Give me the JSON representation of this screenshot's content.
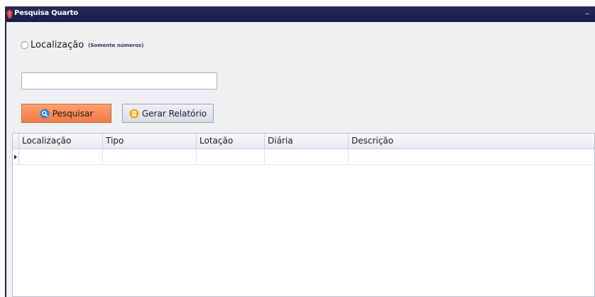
{
  "window": {
    "title": "Pesquisa Quarto",
    "minimize_label": "–"
  },
  "search": {
    "radio_label": "Localização",
    "radio_hint": "(Somente números)",
    "input_value": "",
    "search_button": "Pesquisar",
    "report_button": "Gerar Relatório"
  },
  "grid": {
    "columns": [
      "Localização",
      "Tipo",
      "Lotação",
      "Diária",
      "Descrição"
    ],
    "rows": [
      [
        "",
        "",
        "",
        "",
        ""
      ]
    ]
  },
  "colors": {
    "titlebar": "#1a1d47",
    "search_button": "#ef7a45",
    "report_button": "#d7dde7"
  },
  "icons": {
    "title": "app-icon",
    "search": "search-icon",
    "report": "report-icon"
  }
}
